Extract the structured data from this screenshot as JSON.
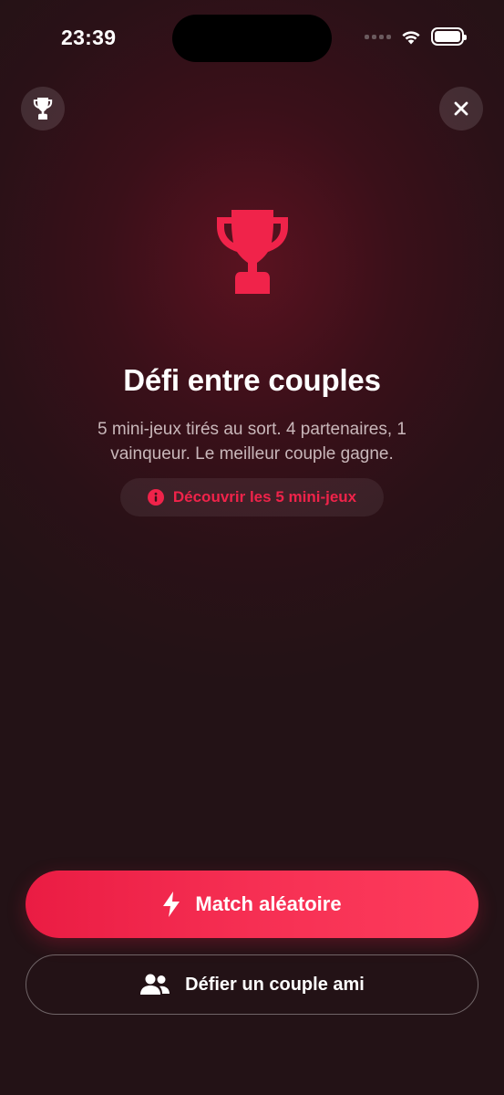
{
  "status_bar": {
    "time": "23:39",
    "icons": [
      "signal-icon",
      "wifi-icon",
      "battery-icon"
    ]
  },
  "header": {
    "left_icon": "trophy-icon",
    "right_icon": "close-icon"
  },
  "hero": {
    "icon": "trophy-icon",
    "title": "Défi entre couples",
    "subtitle": "5 mini-jeux tirés au sort. 4 partenaires, 1 vainqueur. Le meilleur couple gagne.",
    "discover_label": "Découvrir les 5 mini-jeux",
    "discover_icon": "info-icon"
  },
  "actions": {
    "primary_label": "Match aléatoire",
    "primary_icon": "bolt-icon",
    "secondary_label": "Défier un couple ami",
    "secondary_icon": "people-icon"
  },
  "colors": {
    "accent": "#f0234a",
    "background": "#2a1117",
    "primary_gradient_start": "#ea1c43",
    "primary_gradient_end": "#fd3c5c",
    "subtitle_text": "#c9b7ba"
  }
}
